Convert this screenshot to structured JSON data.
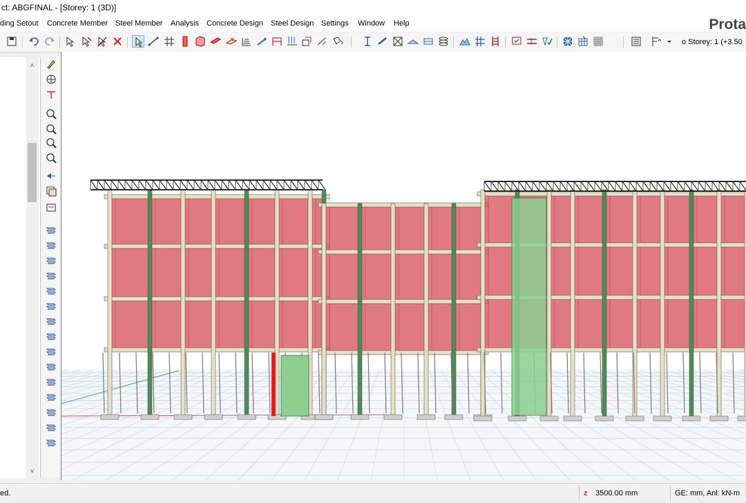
{
  "window": {
    "title": "ct: ABGFINAL - [Storey: 1 (3D)]"
  },
  "brand": {
    "label": "Prota"
  },
  "menu": {
    "items": [
      {
        "label": "ding Setout"
      },
      {
        "label": "Concrete Member"
      },
      {
        "label": "Steel Member"
      },
      {
        "label": "Analysis"
      },
      {
        "label": "Concrete Design"
      },
      {
        "label": "Steel Design"
      },
      {
        "label": "Settings"
      },
      {
        "label": "Window"
      },
      {
        "label": "Help"
      }
    ]
  },
  "toolbar": {
    "storey_label": "o  Storey: 1 (+3.50",
    "icons": [
      "save-icon",
      "undo-icon",
      "redo-icon",
      "select-icon",
      "select-filter-icon",
      "deselect-icon",
      "delete-icon",
      "pointer-icon",
      "line-icon",
      "grid-icon",
      "column-icon",
      "wall-icon",
      "beam-icon",
      "slab-icon",
      "stair-icon",
      "brace-icon",
      "frame-icon",
      "load-icon",
      "section-icon",
      "dimension-icon",
      "steel-column-icon",
      "steel-beam-icon",
      "steel-brace-icon",
      "truss-icon",
      "footing-icon",
      "pile-icon",
      "roof-icon",
      "ladder-icon",
      "check-icon",
      "design-icon",
      "verify-icon",
      "mesh-icon",
      "table-icon",
      "properties-icon",
      "storey-dropdown-icon"
    ]
  },
  "left_tools": {
    "icons": [
      "pencil-icon",
      "target-icon",
      "axis-icon",
      "zoom-icon",
      "rotate-icon",
      "zoom-in-icon",
      "zoom-window-icon",
      "pan-icon",
      "layers-icon",
      "view-icon",
      "storey-1-icon",
      "storey-2-icon",
      "storey-3-icon",
      "storey-4-icon",
      "storey-5-icon",
      "storey-6-icon",
      "storey-7-icon",
      "storey-8-icon",
      "storey-9-icon",
      "storey-10-icon",
      "storey-11-icon",
      "storey-12-icon",
      "storey-13-icon",
      "storey-14-icon",
      "storey-15-icon"
    ]
  },
  "status": {
    "left_text": "ed.",
    "elevation": "3500.00 mm",
    "units": "GE: mm,  Anl: kN-m"
  },
  "colors": {
    "infill": "#d9555c",
    "column_green": "#4f8a57",
    "core_green": "#8ccf8e",
    "beam_tan": "#e8e0c4",
    "truss": "#2b2b2b",
    "grid": "#c9d6e4"
  }
}
